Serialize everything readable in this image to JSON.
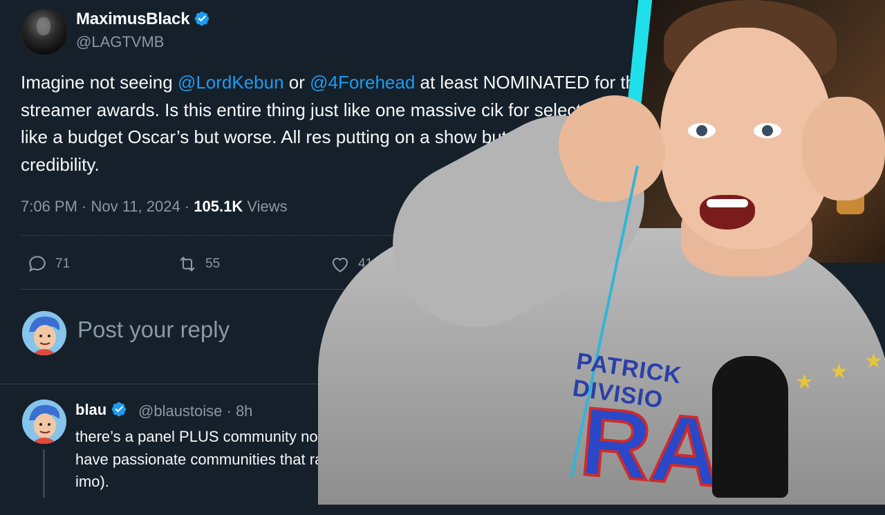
{
  "tweet": {
    "display_name": "MaximusBlack",
    "handle": "@LAGTVMB",
    "more": "•••",
    "text_parts": {
      "p1": "Imagine not seeing ",
      "m1": "@LordKebun",
      "p2": " or ",
      "m2": "@4Forehead",
      "p3": " at least NOMINATED for the streamer awards. Is this entire thing just like one massive ci",
      "p4": "k for select circles? It’s like a budget Oscar’s but worse. All res",
      "p5": " putting on a show but my god there’s no credibility."
    },
    "time": "7:06 PM · Nov 11, 2024 · ",
    "views_count": "105.1K",
    "views_label": " Views",
    "actions": {
      "replies": "71",
      "reposts": "55",
      "likes": "410"
    },
    "reply_placeholder": "Post your reply"
  },
  "reply": {
    "name": "blau",
    "handle": "@blaustoise · 8h",
    "text": "there’s a panel PLUS community nominations. Fanum, Esfan Chatterbox all have passionate communities that rallied to no (and CB had the best arc of 4.0 imo)."
  },
  "overlay": {
    "jersey_line1": "PATRICK DIVISIO",
    "jersey_big": "RAN"
  },
  "colors": {
    "background": "#15202b",
    "accent": "#1d9bf0",
    "muted": "#8b98a5"
  }
}
